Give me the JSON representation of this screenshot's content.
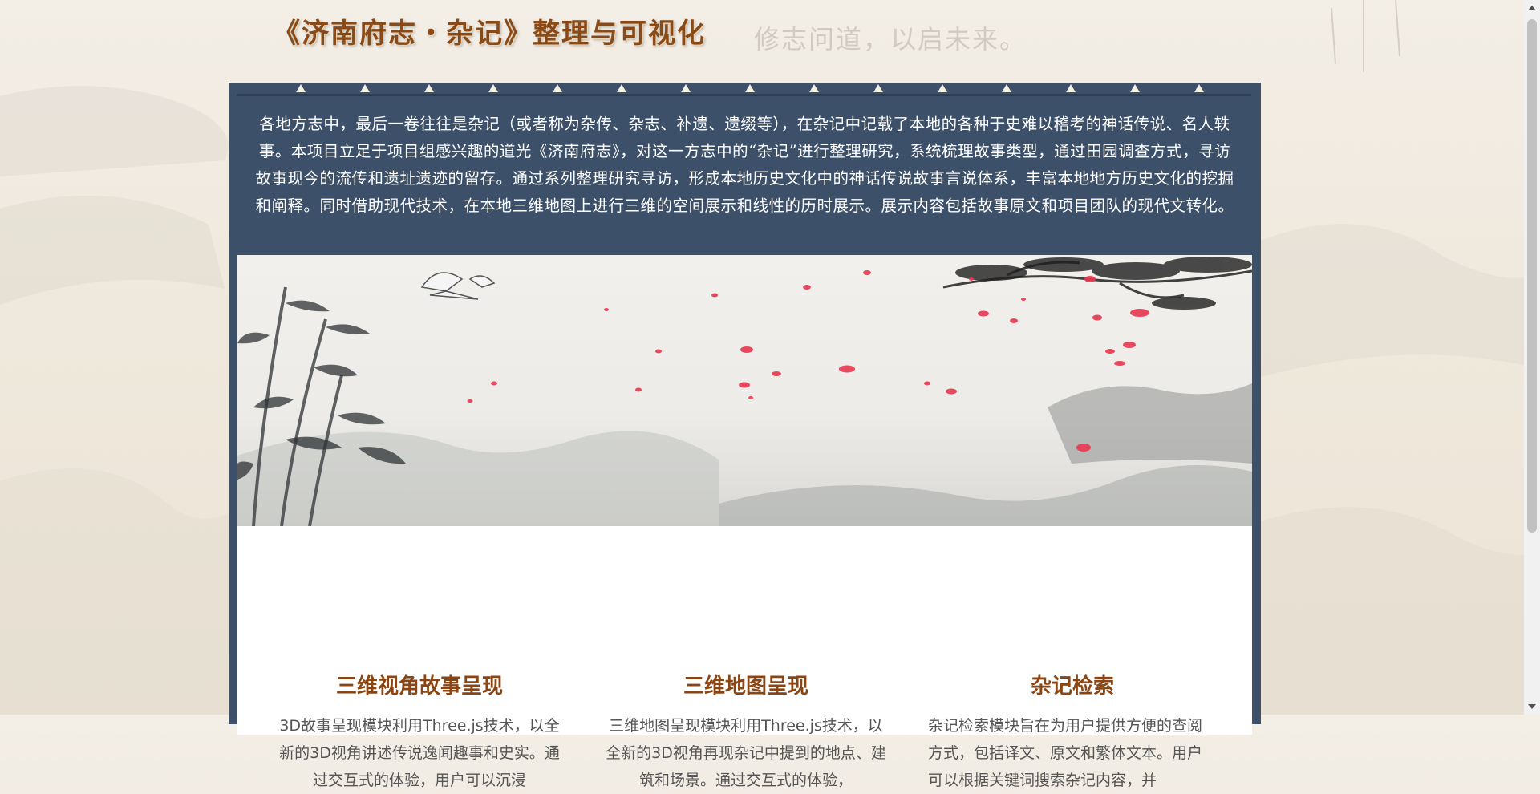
{
  "header": {
    "title": "《济南府志・杂记》整理与可视化",
    "motto": "修志问道，以启未来。"
  },
  "intro": {
    "text": "各地方志中，最后一卷往往是杂记（或者称为杂传、杂志、补遗、遗缀等），在杂记中记载了本地的各种于史难以稽考的神话传说、名人轶事。本项目立足于项目组感兴趣的道光《济南府志》，对这一方志中的“杂记”进行整理研究，系统梳理故事类型，通过田园调查方式，寻访故事现今的流传和遗址遗迹的留存。通过系列整理研究寻访，形成本地历史文化中的神话传说故事言说体系，丰富本地地方历史文化的挖掘和阐释。同时借助现代技术，在本地三维地图上进行三维的空间展示和线性的历时展示。展示内容包括故事原文和项目团队的现代文转化。"
  },
  "features": [
    {
      "title": "三维视角故事呈现",
      "desc": "3D故事呈现模块利用Three.js技术，以全新的3D视角讲述传说逸闻趣事和史实。通过交互式的体验，用户可以沉浸"
    },
    {
      "title": "三维地图呈现",
      "desc": "三维地图呈现模块利用Three.js技术，以全新的3D视角再现杂记中提到的地点、建筑和场景。通过交互式的体验，"
    },
    {
      "title": "杂记检索",
      "desc": "杂记检索模块旨在为用户提供方便的查阅方式，包括译文、原文和繁体文本。用户可以根据关键词搜索杂记内容，并"
    }
  ],
  "colors": {
    "title": "#8a4a18",
    "frame": "#3d5069",
    "feature_title": "#8b4513",
    "petal": "#e8374f"
  },
  "icons": [
    "decorative-triangle-strip",
    "crane-icon",
    "bamboo-illustration",
    "pine-branch-illustration"
  ]
}
